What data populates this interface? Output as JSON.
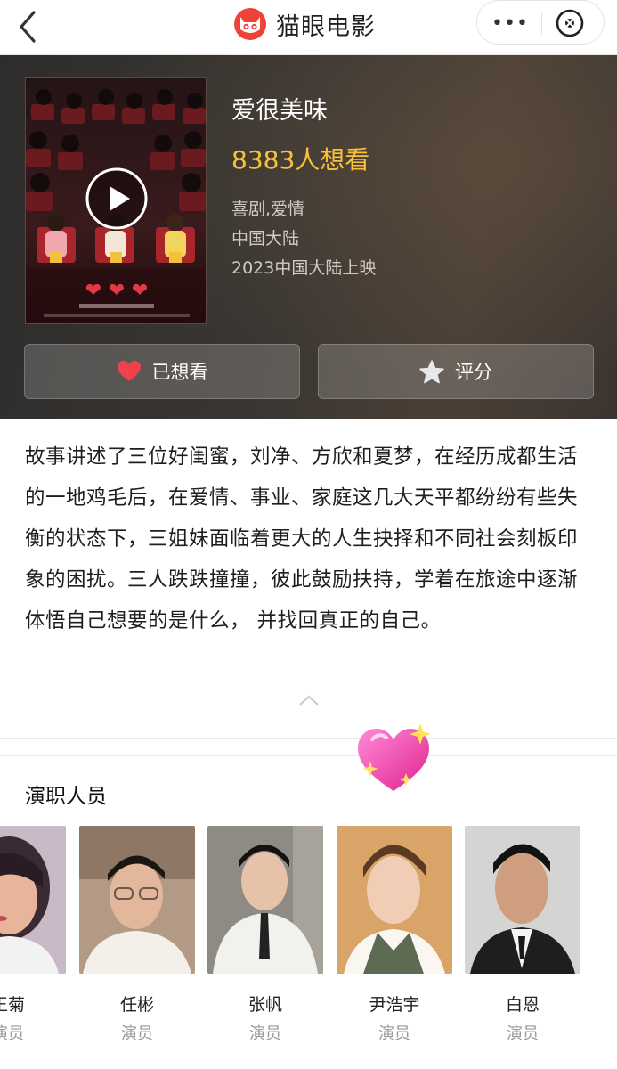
{
  "header": {
    "app_name": "猫眼电影",
    "back_icon": "chevron-left-icon",
    "more_label": "•••",
    "close_icon": "close-circle-icon",
    "brand_color": "#ef4238"
  },
  "movie": {
    "title": "爱很美味",
    "want_count": "8383人想看",
    "genre": "喜剧,爱情",
    "region": "中国大陆",
    "release": "2023中国大陆上映",
    "accent_color": "#f7c23a"
  },
  "actions": {
    "want_label": "已想看",
    "want_icon": "heart-icon",
    "rate_label": "评分",
    "rate_icon": "star-icon"
  },
  "synopsis": {
    "text": "故事讲述了三位好闺蜜，刘净、方欣和夏梦，在经历成都生活的一地鸡毛后，在爱情、事业、家庭这几大天平都纷纷有些失衡的状态下，三姐妹面临着更大的人生抉择和不同社会刻板印象的困扰。三人跌跌撞撞，彼此鼓励扶持，学着在旅途中逐渐体悟自己想要的是什么， 并找回真正的自己。"
  },
  "cast": {
    "title": "演职人员",
    "members": [
      {
        "name": "王菊",
        "role": "演员"
      },
      {
        "name": "任彬",
        "role": "演员"
      },
      {
        "name": "张帆",
        "role": "演员"
      },
      {
        "name": "尹浩宇",
        "role": "演员"
      },
      {
        "name": "白恩",
        "role": "演员"
      }
    ]
  }
}
